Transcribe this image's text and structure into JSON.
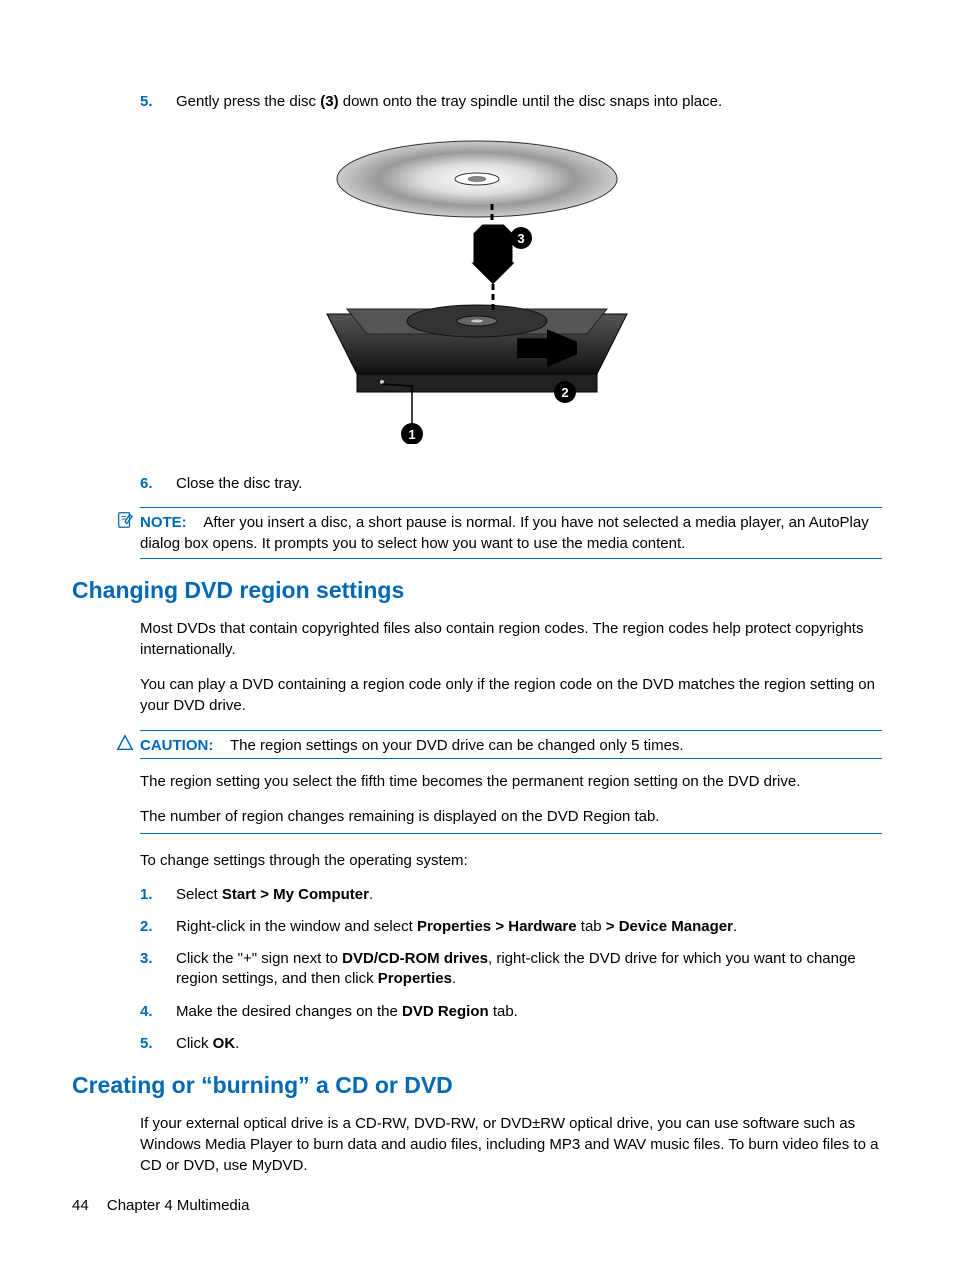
{
  "steps_top": [
    {
      "num": "5.",
      "prefix": "Gently press the disc ",
      "bold": "(3)",
      "suffix": " down onto the tray spindle until the disc snaps into place."
    },
    {
      "num": "6.",
      "prefix": "Close the disc tray.",
      "bold": "",
      "suffix": ""
    }
  ],
  "note": {
    "label": "NOTE:",
    "text": "After you insert a disc, a short pause is normal. If you have not selected a media player, an AutoPlay dialog box opens. It prompts you to select how you want to use the media content."
  },
  "section1": {
    "heading": "Changing DVD region settings",
    "p1": "Most DVDs that contain copyrighted files also contain region codes. The region codes help protect copyrights internationally.",
    "p2": "You can play a DVD containing a region code only if the region code on the DVD matches the region setting on your DVD drive."
  },
  "caution": {
    "label": "CAUTION:",
    "line1": "The region settings on your DVD drive can be changed only 5 times.",
    "line2": "The region setting you select the fifth time becomes the permanent region setting on the DVD drive.",
    "line3": "The number of region changes remaining is displayed on the DVD Region tab."
  },
  "section1_p3": "To change settings through the operating system:",
  "steps_mid": [
    {
      "num": "1.",
      "parts": [
        {
          "t": "Select "
        },
        {
          "b": "Start > My Computer"
        },
        {
          "t": "."
        }
      ]
    },
    {
      "num": "2.",
      "parts": [
        {
          "t": "Right-click in the window and select "
        },
        {
          "b": "Properties > Hardware"
        },
        {
          "t": " tab "
        },
        {
          "b": "> Device Manager"
        },
        {
          "t": "."
        }
      ]
    },
    {
      "num": "3.",
      "parts": [
        {
          "t": "Click the \"+\" sign next to "
        },
        {
          "b": "DVD/CD-ROM drives"
        },
        {
          "t": ", right-click the DVD drive for which you want to change region settings, and then click "
        },
        {
          "b": "Properties"
        },
        {
          "t": "."
        }
      ]
    },
    {
      "num": "4.",
      "parts": [
        {
          "t": "Make the desired changes on the "
        },
        {
          "b": "DVD Region"
        },
        {
          "t": " tab."
        }
      ]
    },
    {
      "num": "5.",
      "parts": [
        {
          "t": "Click "
        },
        {
          "b": "OK"
        },
        {
          "t": "."
        }
      ]
    }
  ],
  "section2": {
    "heading": "Creating or “burning” a CD or DVD",
    "p1": "If your external optical drive is a CD-RW, DVD-RW, or DVD±RW optical drive, you can use software such as Windows Media Player to burn data and audio files, including MP3 and WAV music files. To burn video files to a CD or DVD, use MyDVD."
  },
  "footer": {
    "page": "44",
    "chapter": "Chapter 4   Multimedia"
  }
}
